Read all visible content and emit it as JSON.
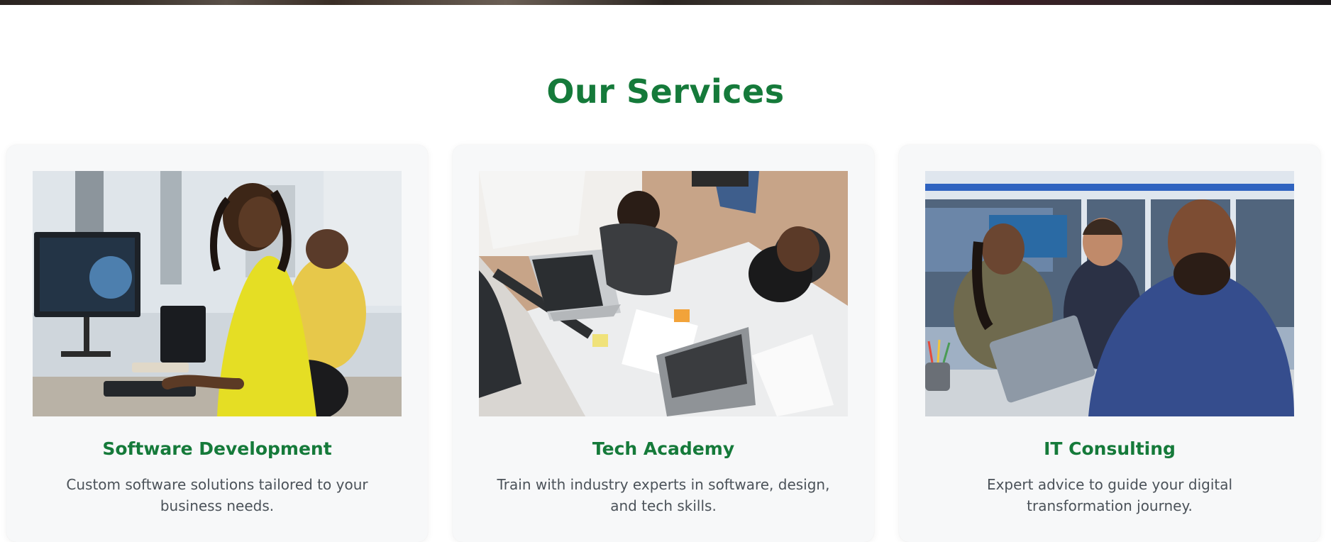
{
  "section": {
    "title": "Our Services"
  },
  "cards": [
    {
      "title": "Software Development",
      "description": "Custom software solutions tailored to your business needs.",
      "image": "woman-coding-at-desk"
    },
    {
      "title": "Tech Academy",
      "description": "Train with industry experts in software, design, and tech skills.",
      "image": "team-collaborating-overhead"
    },
    {
      "title": "IT Consulting",
      "description": "Expert advice to guide your digital transformation journey.",
      "image": "consultants-in-server-room"
    }
  ],
  "colors": {
    "accent": "#157a3a",
    "card_background": "#f7f8f9",
    "body_text": "#4b5259"
  }
}
